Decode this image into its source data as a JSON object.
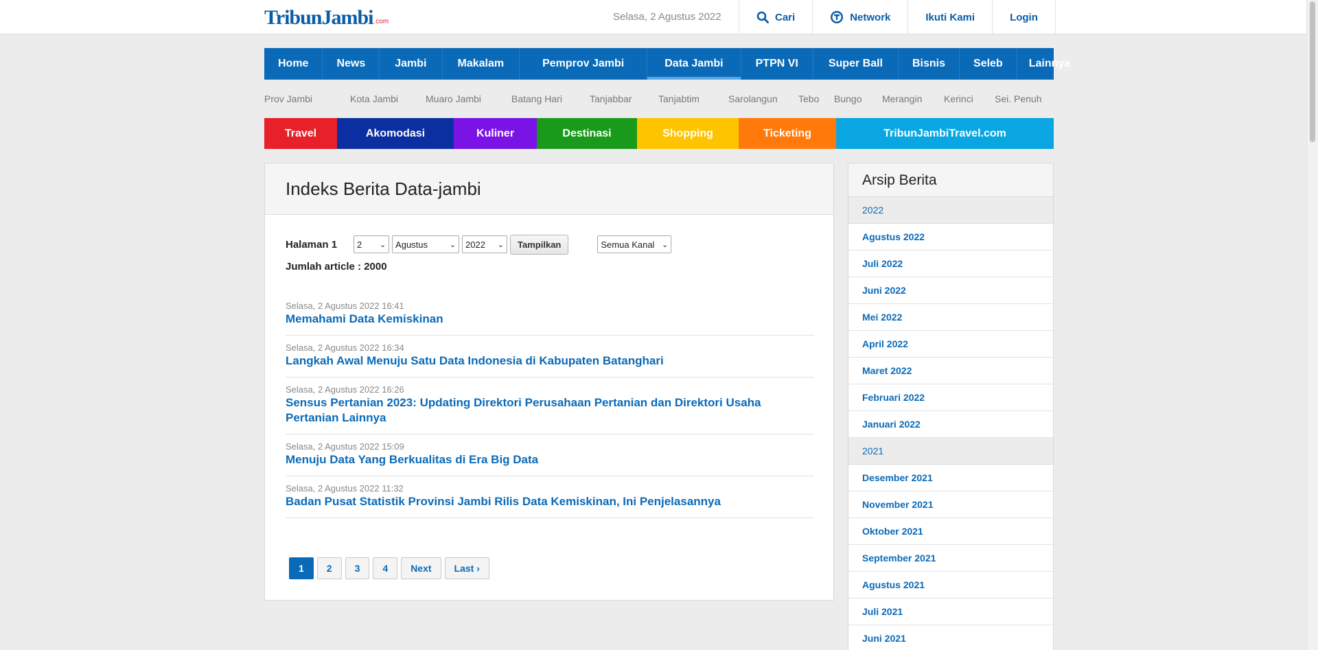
{
  "header": {
    "logo_main": "TribunJambi",
    "logo_sub": ".com",
    "date": "Selasa, 2 Agustus 2022",
    "links": [
      {
        "label": "Cari",
        "icon": "search-icon"
      },
      {
        "label": "Network",
        "icon": "tribun-network-icon"
      },
      {
        "label": "Ikuti Kami",
        "icon": ""
      },
      {
        "label": "Login",
        "icon": ""
      }
    ]
  },
  "main_nav": {
    "items": [
      "Home",
      "News",
      "Jambi",
      "Makalam",
      "Pemprov Jambi",
      "Data Jambi",
      "PTPN VI",
      "Super Ball",
      "Bisnis",
      "Seleb",
      "Lainnya"
    ],
    "active": "Data Jambi"
  },
  "sub_nav": {
    "items": [
      "Prov Jambi",
      "Kota Jambi",
      "Muaro Jambi",
      "Batang Hari",
      "Tanjabbar",
      "Tanjabtim",
      "Sarolangun",
      "Tebo",
      "Bungo",
      "Merangin",
      "Kerinci",
      "Sei. Penuh"
    ]
  },
  "category_bar": {
    "items": [
      {
        "label": "Travel",
        "color": "#e8202a"
      },
      {
        "label": "Akomodasi",
        "color": "#0b2fa0"
      },
      {
        "label": "Kuliner",
        "color": "#7a14e6"
      },
      {
        "label": "Destinasi",
        "color": "#1a9a1a"
      },
      {
        "label": "Shopping",
        "color": "#ffc400"
      },
      {
        "label": "Ticketing",
        "color": "#ff7a0a"
      },
      {
        "label": "TribunJambiTravel.com",
        "color": "#09a6e2"
      }
    ]
  },
  "main": {
    "title": "Indeks Berita Data-jambi",
    "page_label": "Halaman 1",
    "day_select": "2",
    "month_select": "Agustus",
    "year_select": "2022",
    "show_button": "Tampilkan",
    "channel_select": "Semua Kanal",
    "count_label": "Jumlah article : 2000",
    "articles": [
      {
        "time": "Selasa, 2 Agustus 2022 16:41",
        "title": "Memahami Data Kemiskinan"
      },
      {
        "time": "Selasa, 2 Agustus 2022 16:34",
        "title": "Langkah Awal Menuju Satu Data Indonesia di Kabupaten Batanghari"
      },
      {
        "time": "Selasa, 2 Agustus 2022 16:26",
        "title": "Sensus Pertanian 2023: Updating Direktori Perusahaan Pertanian dan Direktori Usaha Pertanian Lainnya"
      },
      {
        "time": "Selasa, 2 Agustus 2022 15:09",
        "title": "Menuju Data Yang Berkualitas di Era Big Data"
      },
      {
        "time": "Selasa, 2 Agustus 2022 11:32",
        "title": "Badan Pusat Statistik Provinsi Jambi Rilis Data Kemiskinan, Ini Penjelasannya"
      }
    ],
    "pagination": [
      "1",
      "2",
      "3",
      "4",
      "Next",
      "Last ›"
    ],
    "current_page": "1"
  },
  "sidebar": {
    "title": "Arsip Berita",
    "groups": [
      {
        "year": "2022",
        "months": [
          "Agustus 2022",
          "Juli 2022",
          "Juni 2022",
          "Mei 2022",
          "April 2022",
          "Maret 2022",
          "Februari 2022",
          "Januari 2022"
        ]
      },
      {
        "year": "2021",
        "months": [
          "Desember 2021",
          "November 2021",
          "Oktober 2021",
          "September 2021",
          "Agustus 2021",
          "Juli 2021",
          "Juni 2021"
        ]
      }
    ]
  },
  "colors": {
    "brand_blue": "#0a6ab8",
    "link_blue": "#0a6ab8",
    "logo_red": "#d6232a"
  }
}
